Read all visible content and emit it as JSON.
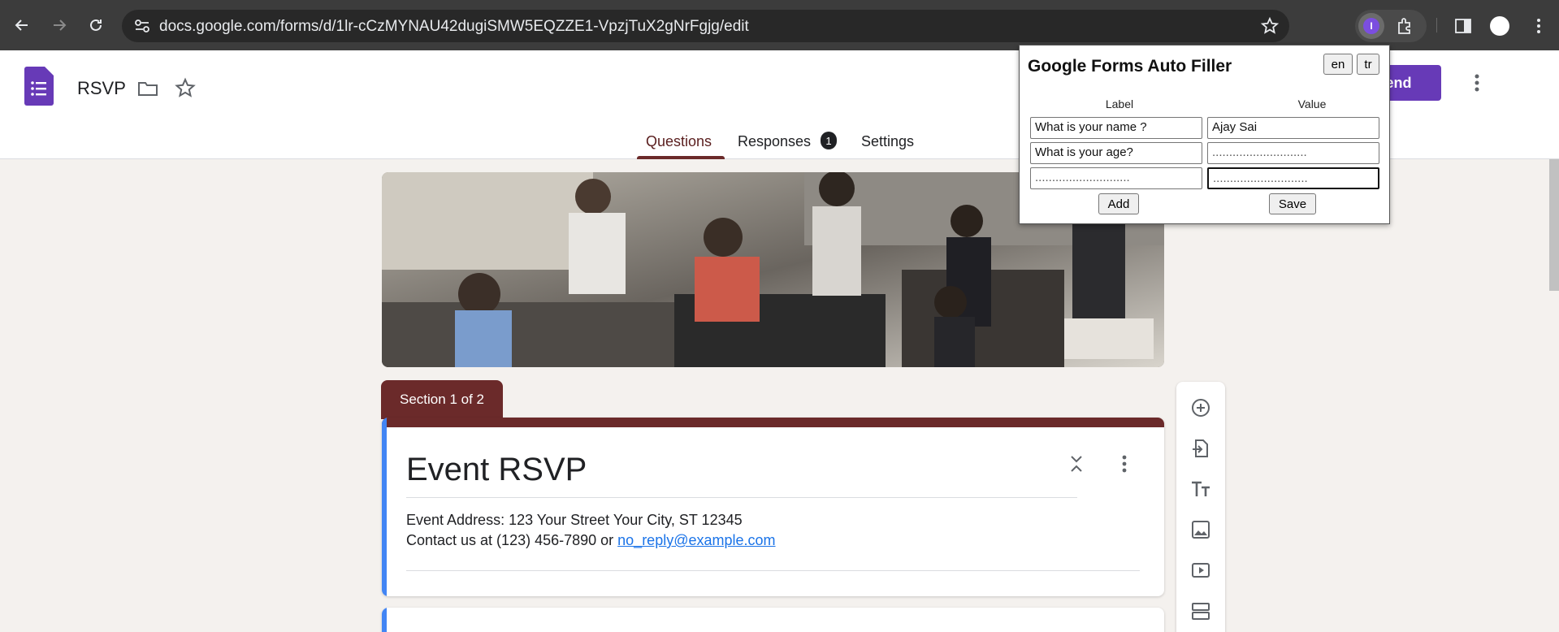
{
  "browser": {
    "url": "docs.google.com/forms/d/1lr-cCzMYNAU42dugiSMW5EQZZE1-VpzjTuX2gNrFgjg/edit",
    "extension_badge": "I"
  },
  "header": {
    "doc_title": "RSVP",
    "send_label": "Send",
    "tabs": [
      {
        "label": "Questions"
      },
      {
        "label": "Responses"
      },
      {
        "label": "Settings"
      }
    ],
    "responses_count": "1"
  },
  "form": {
    "section_label": "Section 1 of 2",
    "title": "Event RSVP",
    "desc_line1": "Event Address: 123 Your Street Your City, ST 12345",
    "desc_line2_prefix": "Contact us at (123) 456-7890 or ",
    "desc_email": "no_reply@example.com"
  },
  "popup": {
    "title": "Google Forms Auto Filler",
    "lang_en": "en",
    "lang_tr": "tr",
    "col_label": "Label",
    "col_value": "Value",
    "rows": [
      {
        "label": "What is your name ?",
        "value": "Ajay Sai"
      },
      {
        "label": "What is your age?",
        "value": "............................"
      },
      {
        "label": "............................",
        "value": "............................"
      }
    ],
    "add_label": "Add",
    "save_label": "Save"
  },
  "icons": {
    "back": "arrow-left-icon",
    "forward": "arrow-right-icon",
    "reload": "reload-icon",
    "bookmark": "star-icon",
    "extensions": "puzzle-icon"
  },
  "colors": {
    "theme": "#6b2a2a",
    "forms_purple": "#673ab7",
    "accent_blue": "#4285f4"
  }
}
